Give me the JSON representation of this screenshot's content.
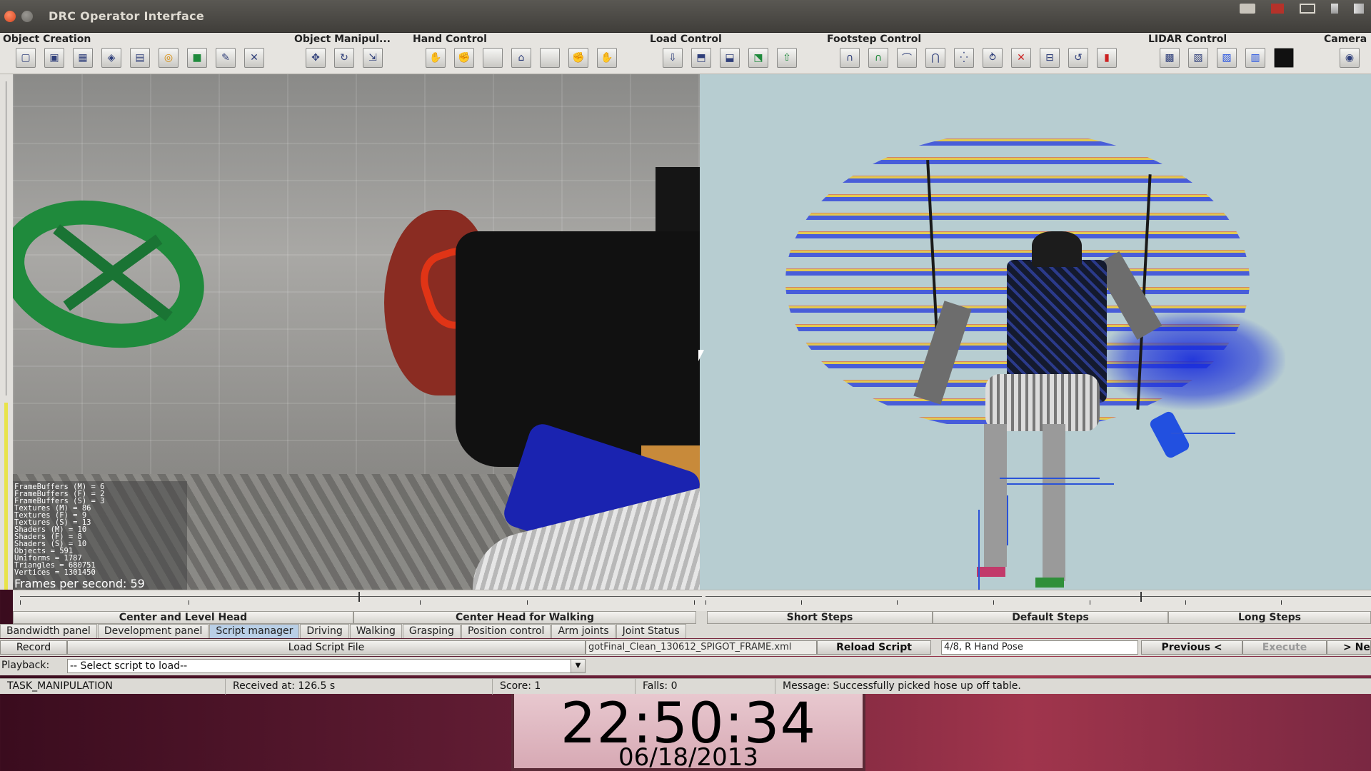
{
  "window": {
    "title": "DRC Operator Interface"
  },
  "toolbar": {
    "groups": [
      {
        "label": "Object Creation",
        "icon_count": 9
      },
      {
        "label": "Object Manipul...",
        "icon_count": 3
      },
      {
        "label": "Hand Control",
        "icon_count": 7
      },
      {
        "label": "Load Control",
        "icon_count": 5
      },
      {
        "label": "Footstep Control",
        "icon_count": 10
      },
      {
        "label": "LIDAR Control",
        "icon_count": 5
      },
      {
        "label": "Camera",
        "icon_count": 1
      }
    ]
  },
  "render_stats": {
    "lines": [
      "FrameBuffers (M) = 6",
      "FrameBuffers (F) = 2",
      "FrameBuffers (S) = 3",
      "Textures (M) = 86",
      "Textures (F) = 9",
      "Textures (S) = 13",
      "Shaders (M) = 10",
      "Shaders (F) = 8",
      "Shaders (S) = 10",
      "Objects = 591",
      "Uniforms = 1787",
      "Triangles = 680751",
      "Vertices = 1301450"
    ],
    "fps": "Frames per second: 59"
  },
  "head_controls": {
    "center_level": "Center and Level Head",
    "center_walking": "Center Head for Walking"
  },
  "step_controls": {
    "short": "Short Steps",
    "default": "Default Steps",
    "long": "Long Steps"
  },
  "tabs": [
    {
      "label": "Bandwidth panel",
      "active": false
    },
    {
      "label": "Development panel",
      "active": false
    },
    {
      "label": "Script manager",
      "active": true
    },
    {
      "label": "Driving",
      "active": false
    },
    {
      "label": "Walking",
      "active": false
    },
    {
      "label": "Grasping",
      "active": false
    },
    {
      "label": "Position control",
      "active": false
    },
    {
      "label": "Arm joints",
      "active": false
    },
    {
      "label": "Joint Status",
      "active": false
    }
  ],
  "script": {
    "record": "Record",
    "load_file": "Load Script File",
    "file_name": "gotFinal_Clean_130612_SPIGOT_FRAME.xml",
    "reload": "Reload Script",
    "step": "4/8, R Hand Pose",
    "previous": "Previous <",
    "execute": "Execute",
    "next": "> Ne"
  },
  "playback": {
    "label": "Playback:",
    "selected": "-- Select script to load--"
  },
  "status": {
    "task": "TASK_MANIPULATION",
    "received": "Received at:  126.5 s",
    "score": "Score:  1",
    "falls": "Falls:  0",
    "message": "Message:  Successfully picked hose up off table."
  },
  "clock": {
    "time": "22:50:34",
    "date": "06/18/2013"
  }
}
